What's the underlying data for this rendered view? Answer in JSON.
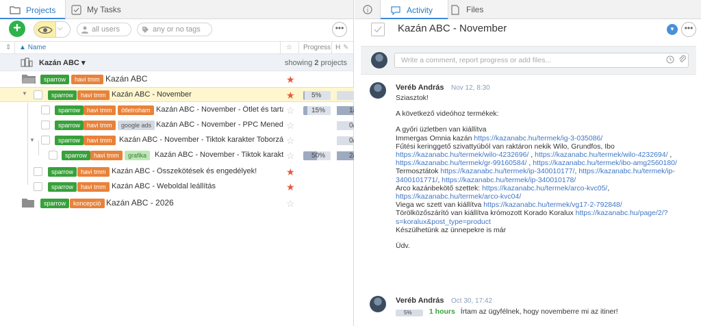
{
  "left_tabs": {
    "projects": "Projects",
    "my_tasks": "My Tasks"
  },
  "filters": {
    "users": "all users",
    "tags": "any or no tags"
  },
  "columns": {
    "name": "Name",
    "progress": "Progress",
    "hours": "H"
  },
  "group": {
    "title": "Kazán ABC",
    "showing": "showing 2 projects",
    "showing_prefix": "showing",
    "showing_count": "2",
    "showing_suffix": "projects"
  },
  "rows": [
    {
      "tags": [
        "sparrow",
        "havi tmm"
      ],
      "title": "Kazán ABC",
      "starred": true
    },
    {
      "tags": [
        "sparrow",
        "havi tmm"
      ],
      "title": "Kazán ABC - November",
      "starred": true,
      "progress": "5%",
      "progress_value": 5,
      "hours": ""
    },
    {
      "tags": [
        "sparrow",
        "havi tmm",
        "ötletroham"
      ],
      "title": "Kazán ABC - November - Ötlet és tarta...",
      "starred": false,
      "progress": "15%",
      "progress_value": 15,
      "hours": "1/"
    },
    {
      "tags": [
        "sparrow",
        "havi tmm",
        "google ads"
      ],
      "title": "Kazán ABC - November - PPC Menedzs...",
      "starred": false,
      "hours": "0/"
    },
    {
      "tags": [
        "sparrow",
        "havi tmm"
      ],
      "title": "Kazán ABC - November - Tiktok karakter Toborzás",
      "starred": false,
      "hours": "0/"
    },
    {
      "tags": [
        "sparrow",
        "havi tmm",
        "grafika"
      ],
      "title": "Kazán ABC - November - Tiktok karakte...",
      "starred": false,
      "progress": "50%",
      "progress_value": 50,
      "hours": "2/"
    },
    {
      "tags": [
        "sparrow",
        "havi tmm"
      ],
      "title": "Kazán ABC - Összekötések és engedélyek!",
      "starred": true
    },
    {
      "tags": [
        "sparrow",
        "havi tmm"
      ],
      "title": "Kazán ABC - Weboldal leállítás",
      "starred": true
    },
    {
      "tags": [
        "sparrow",
        "koncepció"
      ],
      "title": "Kazán ABC - 2026",
      "starred": false
    }
  ],
  "right_tabs": {
    "info": "i",
    "activity": "Activity",
    "files": "Files"
  },
  "task_title": "Kazán ABC - November",
  "composer_placeholder": "Write a comment, report progress or add files...",
  "entries": [
    {
      "author": "Veréb András",
      "date": "Nov 12, 8:30",
      "lines": [
        [
          {
            "t": "Sziasztok!"
          }
        ],
        [],
        [
          {
            "t": "A következő videóhoz termékek:"
          }
        ],
        [],
        [
          {
            "t": "A győri üzletben van kiállítva"
          }
        ],
        [
          {
            "t": "Immergas Omnia kazán "
          },
          {
            "t": "https://kazanabc.hu/termek/ig-3-035086/",
            "link": true
          }
        ],
        [
          {
            "t": "Fűtési keringgető szivattyúból van raktáron nekik Wilo, Grundfos, Ibo"
          }
        ],
        [
          {
            "t": "https://kazanabc.hu/termek/wilo-4232696/",
            "link": true
          },
          {
            "t": " , "
          },
          {
            "t": "https://kazanabc.hu/termek/wilo-4232694/",
            "link": true
          },
          {
            "t": " ,"
          }
        ],
        [
          {
            "t": "https://kazanabc.hu/termek/gr-99160584/",
            "link": true
          },
          {
            "t": " , "
          },
          {
            "t": "https://kazanabc.hu/termek/ibo-amg2560180/",
            "link": true
          }
        ],
        [
          {
            "t": "Termosztátok "
          },
          {
            "t": "https://kazanabc.hu/termek/ip-340010177/",
            "link": true
          },
          {
            "t": ", "
          },
          {
            "t": "https://kazanabc.hu/termek/ip-",
            "link": true
          }
        ],
        [
          {
            "t": "3400101771/",
            "link": true
          },
          {
            "t": ", "
          },
          {
            "t": "https://kazanabc.hu/termek/ip-340010178/",
            "link": true
          }
        ],
        [
          {
            "t": "Arco kazánbekötő szettek: "
          },
          {
            "t": "https://kazanabc.hu/termek/arco-kvc05/",
            "link": true
          },
          {
            "t": ","
          }
        ],
        [
          {
            "t": "https://kazanabc.hu/termek/arco-kvc04/",
            "link": true
          }
        ],
        [
          {
            "t": "Viega wc szett van kiállítva "
          },
          {
            "t": "https://kazanabc.hu/termek/vg17-2-792848/",
            "link": true
          }
        ],
        [
          {
            "t": "Törölközőszárító van kiállítva krómozott Korado Koralux "
          },
          {
            "t": "https://kazanabc.hu/page/2/?",
            "link": true
          }
        ],
        [
          {
            "t": "s=koralux&post_type=product",
            "link": true
          }
        ],
        [
          {
            "t": "Készülhetünk az ünnepekre is már"
          }
        ],
        [],
        [
          {
            "t": "Üdv."
          }
        ]
      ]
    },
    {
      "author": "Veréb András",
      "date": "Oct 30, 17:42",
      "progress": "5%",
      "hours": "1 hours",
      "text": "Írtam az ügyfélnek, hogy novemberre mi az itiner!"
    }
  ]
}
